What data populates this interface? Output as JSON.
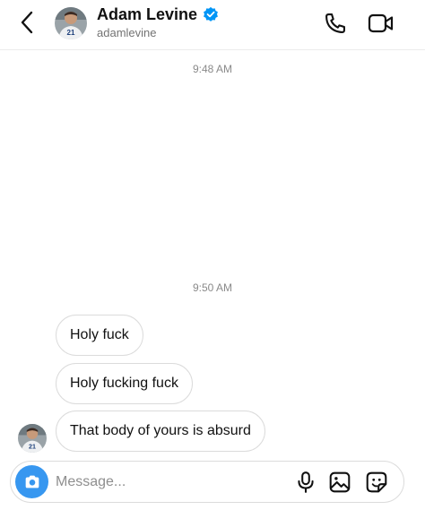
{
  "header": {
    "name": "Adam Levine",
    "username": "adamlevine",
    "verified": true,
    "jersey_number": "21",
    "icons": {
      "back": "chevron-left-icon",
      "call": "phone-icon",
      "video": "video-camera-icon",
      "verified": "verified-badge-icon"
    }
  },
  "thread": {
    "timestamps": [
      "9:48 AM",
      "9:50 AM"
    ],
    "messages": [
      {
        "text": "Holy fuck"
      },
      {
        "text": "Holy fucking fuck"
      },
      {
        "text": "That body of yours is absurd"
      }
    ]
  },
  "composer": {
    "placeholder": "Message...",
    "value": "",
    "icons": {
      "camera": "camera-icon",
      "mic": "microphone-icon",
      "gallery": "gallery-icon",
      "sticker": "sticker-icon"
    }
  },
  "colors": {
    "accent_blue": "#3797f0",
    "bubble_border": "#dbdbdb",
    "timestamp": "#8a8a8a",
    "username": "#737373"
  }
}
